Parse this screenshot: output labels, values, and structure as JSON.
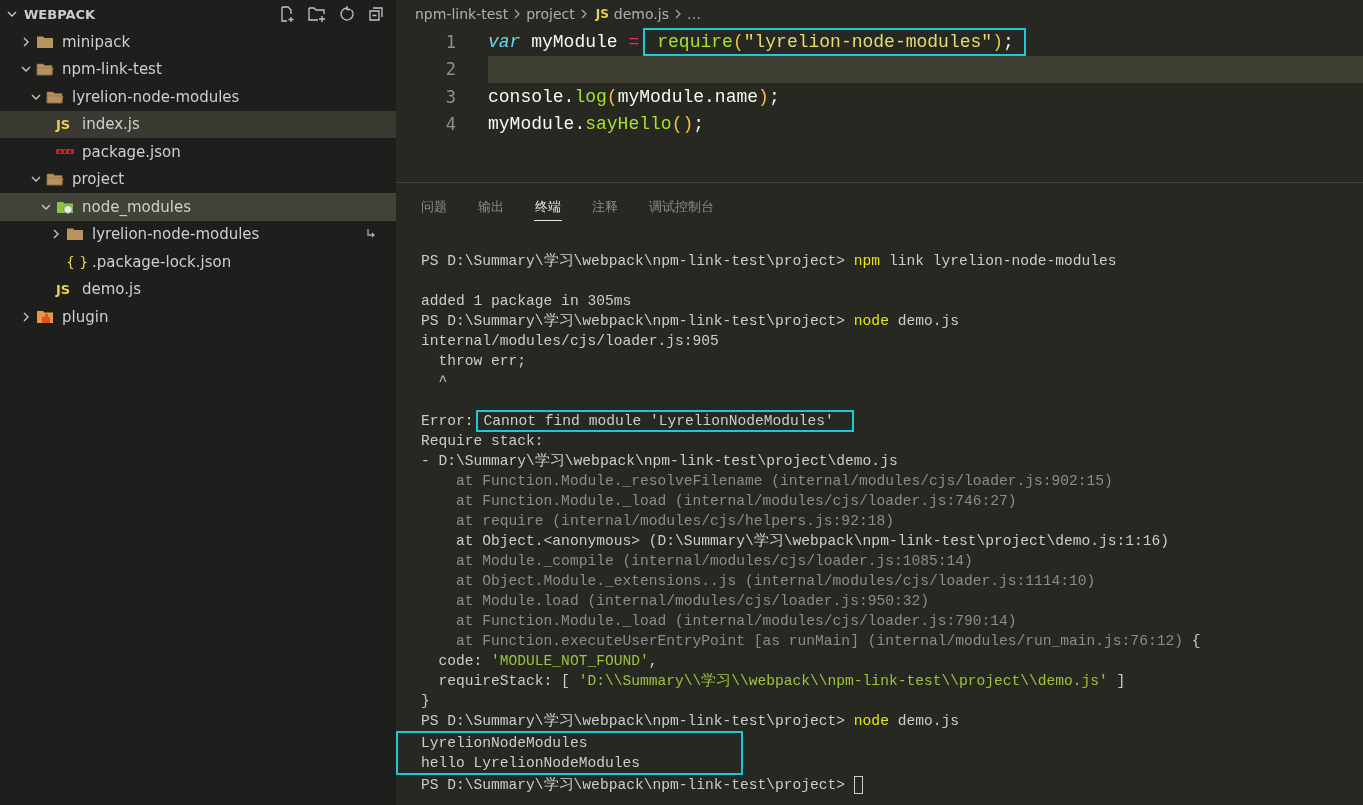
{
  "explorer": {
    "title": "WEBPACK",
    "tree": [
      {
        "label": "minipack",
        "kind": "folder",
        "expanded": false,
        "selected": false,
        "focused": false
      },
      {
        "label": "npm-link-test",
        "kind": "folder",
        "expanded": true,
        "selected": false,
        "focused": false,
        "children": [
          {
            "label": "lyrelion-node-modules",
            "kind": "folder",
            "expanded": true,
            "selected": false,
            "focused": false,
            "children": [
              {
                "label": "index.js",
                "kind": "js",
                "icon_text": "JS",
                "selected": true,
                "focused": false
              },
              {
                "label": "package.json",
                "kind": "npm",
                "selected": false,
                "focused": false
              }
            ]
          },
          {
            "label": "project",
            "kind": "folder",
            "expanded": true,
            "selected": false,
            "focused": false,
            "children": [
              {
                "label": "node_modules",
                "kind": "node_folder",
                "expanded": true,
                "selected": true,
                "focused": true,
                "children": [
                  {
                    "label": "lyrelion-node-modules",
                    "kind": "folder",
                    "expanded": false,
                    "selected": false,
                    "focused": false,
                    "symlink": true
                  },
                  {
                    "label": ".package-lock.json",
                    "kind": "json",
                    "icon_text": "{ }",
                    "selected": false,
                    "focused": false
                  }
                ]
              },
              {
                "label": "demo.js",
                "kind": "js",
                "icon_text": "JS",
                "selected": false,
                "focused": false
              }
            ]
          }
        ]
      },
      {
        "label": "plugin",
        "kind": "plugin_folder",
        "expanded": false,
        "selected": false,
        "focused": false
      }
    ]
  },
  "breadcrumbs": [
    {
      "label": "npm-link-test"
    },
    {
      "label": "project"
    },
    {
      "label": "demo.js",
      "icon_text": "JS"
    },
    {
      "label": "…"
    }
  ],
  "editor": {
    "lines": [
      {
        "number": "1",
        "current": false,
        "segments": [
          {
            "text": "var",
            "kind": "keyword"
          },
          {
            "text": " myModule ",
            "kind": "plain"
          },
          {
            "text": "=",
            "kind": "operator"
          },
          {
            "boxed": true,
            "tokens": [
              {
                "text": "require",
                "kind": "func"
              },
              {
                "text": "(",
                "kind": "bracket"
              },
              {
                "text": "\"lyrelion-node-modules\"",
                "kind": "string"
              },
              {
                "text": ")",
                "kind": "bracket"
              },
              {
                "text": ";",
                "kind": "plain"
              }
            ]
          }
        ]
      },
      {
        "number": "2",
        "current": true
      },
      {
        "number": "3",
        "current": false,
        "segments": [
          {
            "text": "console.",
            "kind": "plain"
          },
          {
            "text": "log",
            "kind": "func"
          },
          {
            "text": "(",
            "kind": "bracket"
          },
          {
            "text": "myModule.name",
            "kind": "plain"
          },
          {
            "text": ")",
            "kind": "bracket"
          },
          {
            "text": ";",
            "kind": "plain"
          }
        ]
      },
      {
        "number": "4",
        "current": false,
        "segments": [
          {
            "text": "myModule.",
            "kind": "plain"
          },
          {
            "text": "sayHello",
            "kind": "func"
          },
          {
            "text": "()",
            "kind": "bracket"
          },
          {
            "text": ";",
            "kind": "plain"
          }
        ]
      }
    ]
  },
  "panel_tabs": [
    {
      "label": "问题",
      "selected": false
    },
    {
      "label": "输出",
      "selected": false
    },
    {
      "label": "终端",
      "selected": true
    },
    {
      "label": "注释",
      "selected": false
    },
    {
      "label": "调试控制台",
      "selected": false
    }
  ],
  "terminal": {
    "lines": [
      {
        "kind": "text",
        "segments": [
          {
            "text": "PS D:\\Summary\\学习\\webpack\\npm-link-test\\project> ",
            "kind": "plain"
          },
          {
            "text": "npm",
            "kind": "command"
          },
          {
            "text": " link lyrelion-node-modules",
            "kind": "plain"
          }
        ]
      },
      {
        "kind": "blank"
      },
      {
        "kind": "text",
        "segments": [
          {
            "text": "added 1 package in 305ms",
            "kind": "plain"
          }
        ]
      },
      {
        "kind": "text",
        "segments": [
          {
            "text": "PS D:\\Summary\\学习\\webpack\\npm-link-test\\project> ",
            "kind": "plain"
          },
          {
            "text": "node",
            "kind": "command"
          },
          {
            "text": " demo.js",
            "kind": "plain"
          }
        ]
      },
      {
        "kind": "text",
        "segments": [
          {
            "text": "internal/modules/cjs/loader.js:905",
            "kind": "plain"
          }
        ]
      },
      {
        "kind": "text",
        "segments": [
          {
            "text": "  throw err;",
            "kind": "plain"
          }
        ]
      },
      {
        "kind": "text",
        "segments": [
          {
            "text": "  ^",
            "kind": "plain"
          }
        ]
      },
      {
        "kind": "blank"
      },
      {
        "kind": "text",
        "segments": [
          {
            "text": "Error:",
            "kind": "plain"
          },
          {
            "boxed": true,
            "tokens": [
              {
                "text": "Cannot find module 'LyrelionNodeModules'",
                "kind": "plain"
              }
            ]
          }
        ]
      },
      {
        "kind": "text",
        "segments": [
          {
            "text": "Require stack:",
            "kind": "plain"
          }
        ]
      },
      {
        "kind": "text",
        "segments": [
          {
            "text": "- D:\\Summary\\学习\\webpack\\npm-link-test\\project\\demo.js",
            "kind": "plain"
          }
        ]
      },
      {
        "kind": "text",
        "segments": [
          {
            "text": "    at Function.Module._resolveFilename (internal/modules/cjs/loader.js:902:15)",
            "kind": "dim"
          }
        ]
      },
      {
        "kind": "text",
        "segments": [
          {
            "text": "    at Function.Module._load (internal/modules/cjs/loader.js:746:27)",
            "kind": "dim"
          }
        ]
      },
      {
        "kind": "text",
        "segments": [
          {
            "text": "    at require (internal/modules/cjs/helpers.js:92:18)",
            "kind": "dim"
          }
        ]
      },
      {
        "kind": "text",
        "segments": [
          {
            "text": "    at Object.<anonymous> (D:\\Summary\\学习\\webpack\\npm-link-test\\project\\demo.js:1:16)",
            "kind": "plain"
          }
        ]
      },
      {
        "kind": "text",
        "segments": [
          {
            "text": "    at Module._compile (internal/modules/cjs/loader.js:1085:14)",
            "kind": "dim"
          }
        ]
      },
      {
        "kind": "text",
        "segments": [
          {
            "text": "    at Object.Module._extensions..js (internal/modules/cjs/loader.js:1114:10)",
            "kind": "dim"
          }
        ]
      },
      {
        "kind": "text",
        "segments": [
          {
            "text": "    at Module.load (internal/modules/cjs/loader.js:950:32)",
            "kind": "dim"
          }
        ]
      },
      {
        "kind": "text",
        "segments": [
          {
            "text": "    at Function.Module._load (internal/modules/cjs/loader.js:790:14)",
            "kind": "dim"
          }
        ]
      },
      {
        "kind": "text",
        "segments": [
          {
            "text": "    at Function.executeUserEntryPoint [as runMain] (internal/modules/run_main.js:76:12)",
            "kind": "dim"
          },
          {
            "text": " {",
            "kind": "plain"
          }
        ]
      },
      {
        "kind": "text",
        "segments": [
          {
            "text": "  code: ",
            "kind": "plain"
          },
          {
            "text": "'MODULE_NOT_FOUND'",
            "kind": "string"
          },
          {
            "text": ",",
            "kind": "plain"
          }
        ]
      },
      {
        "kind": "text",
        "segments": [
          {
            "text": "  requireStack: [ ",
            "kind": "plain"
          },
          {
            "text": "'D:\\\\Summary\\\\学习\\\\webpack\\\\npm-link-test\\\\project\\\\demo.js'",
            "kind": "string"
          },
          {
            "text": " ]",
            "kind": "plain"
          }
        ]
      },
      {
        "kind": "text",
        "segments": [
          {
            "text": "}",
            "kind": "plain"
          }
        ]
      },
      {
        "kind": "text",
        "segments": [
          {
            "text": "PS D:\\Summary\\学习\\webpack\\npm-link-test\\project> ",
            "kind": "plain"
          },
          {
            "text": "node",
            "kind": "command"
          },
          {
            "text": " demo.js",
            "kind": "plain"
          }
        ]
      },
      {
        "kind": "group",
        "boxed": true,
        "lines": [
          {
            "kind": "text",
            "segments": [
              {
                "text": "LyrelionNodeModules",
                "kind": "plain"
              }
            ]
          },
          {
            "kind": "text",
            "segments": [
              {
                "text": "hello LyrelionNodeModules",
                "kind": "plain"
              }
            ]
          }
        ]
      },
      {
        "kind": "text",
        "cursor": true,
        "segments": [
          {
            "text": "PS D:\\Summary\\学习\\webpack\\npm-link-test\\project> ",
            "kind": "plain"
          }
        ]
      }
    ]
  }
}
